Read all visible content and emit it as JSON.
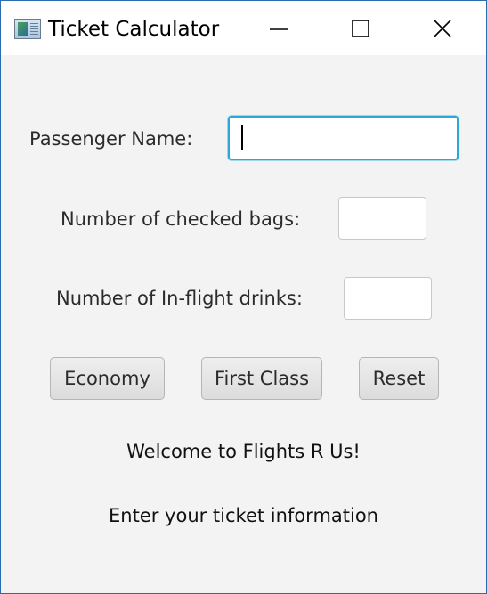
{
  "window": {
    "title": "Ticket Calculator"
  },
  "form": {
    "passenger_name_label": "Passenger Name:",
    "passenger_name_value": "",
    "checked_bags_label": "Number of checked bags:",
    "checked_bags_value": "",
    "drinks_label": "Number of In-flight drinks:",
    "drinks_value": ""
  },
  "buttons": {
    "economy": "Economy",
    "first_class": "First Class",
    "reset": "Reset"
  },
  "messages": {
    "welcome": "Welcome to Flights R Us!",
    "instruction": "Enter your ticket information"
  },
  "colors": {
    "focus_border": "#2ca8d8",
    "window_background": "#f3f3f3",
    "desktop": "#1e4b7a"
  }
}
